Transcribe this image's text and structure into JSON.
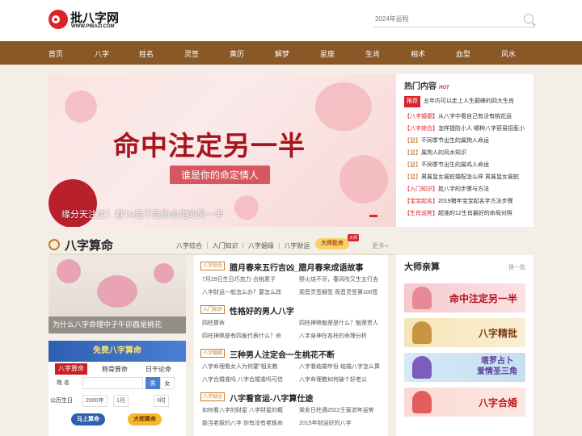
{
  "header": {
    "logo_name": "批八字网",
    "logo_domain": "WWW.PIBAZI.COM",
    "search_placeholder": "2024年运程"
  },
  "nav": {
    "items": [
      "首页",
      "八字",
      "姓名",
      "灵签",
      "黄历",
      "解梦",
      "星座",
      "生肖",
      "相术",
      "血型",
      "风水"
    ]
  },
  "banner": {
    "headline": "命中注定另一半",
    "subline": "谁是你的命定情人",
    "caption": "缘分天注定！看TA是不是你命定的另一半"
  },
  "hot": {
    "title": "热门内容",
    "title_tag": "HOT",
    "top_tag": "推荐",
    "top_text": "五年内可以走上人生巅峰的四大生肖",
    "items": [
      {
        "cat": "【八字婚姻】",
        "text": "从八字中看自己有没有桃花运"
      },
      {
        "cat": "【八字综合】",
        "text": "怎样提防小人 哪种八字容易招惹小"
      },
      {
        "cat": "【鼠】",
        "text": "不同季节出生的属狗人命运"
      },
      {
        "cat": "【鼠】",
        "text": "属狗人的风水知识"
      },
      {
        "cat": "【鼠】",
        "text": "不同季节出生的属鸡人命运"
      },
      {
        "cat": "【鼠】",
        "text": "男属鼠女属蛇婚配怎么样 男属鼠女属蛇"
      },
      {
        "cat": "【入门知识】",
        "text": "批八字的步骤与方法"
      },
      {
        "cat": "【宝宝起名】",
        "text": "2019猪年宝宝起名字方法步骤"
      },
      {
        "cat": "【生肖运势】",
        "text": "超准的12生肖最好的命局对照"
      }
    ]
  },
  "section": {
    "title": "八字算命",
    "links": "八字综合 ｜ 入门知识 ｜ 八字姻缘 ｜ 八字财运",
    "badge": "大师批命",
    "badge_tag": "大师",
    "more": "更多+"
  },
  "feature": {
    "caption": "为什么八字命理中子午卯酉是桃花"
  },
  "calc": {
    "head": "免费八字算命",
    "tabs": [
      "八字算命",
      "称骨算命",
      "日干论命"
    ],
    "name_label": "姓 名",
    "sex_male": "男",
    "sex_female": "女",
    "birth_label": "公历生日",
    "year": "2000年",
    "month": "1月",
    "hour": "0时",
    "btn_quick": "马上算命",
    "btn_master": "大师算命"
  },
  "articles": [
    {
      "cat": "八字综合",
      "title": "腊月春来五行吉凶_腊月春来成语故事",
      "lines": [
        "7月29日生日巧克力·合桃君子",
        "野火烧不尽，春风吹又生五行吉",
        "八字财运一般怎么办？要怎么改",
        "观音灵签解签 观音灵签第100签"
      ]
    },
    {
      "cat": "入门知识",
      "title": "性格好的男人八字",
      "lines": [
        "四柱算命",
        "四柱神煞魁罡是什么？魁罡贵人",
        "四柱神煞是有四废代表什么？命",
        "八字身神在各柱的命理分析"
      ]
    },
    {
      "cat": "八字婚姻",
      "title": "三种男人注定会一生桃花不断",
      "lines": [
        "八字命理看女人为何要\"相夫教",
        "八字看结婚年份 结婚八字怎么算",
        "八字合婚准吗 八字合婚准吗可信",
        "八字命理教如何破个好老公"
      ]
    },
    {
      "cat": "八字财运",
      "title": "八字看官运-八字算仕途",
      "lines": [
        "如何看八字的财星 八字财星的概",
        "癸亥日柱遇2022壬寅流年运势",
        "能当老板的八字 你有没有老板命",
        "2015年财运好的八字"
      ]
    }
  ],
  "masters": {
    "title": "大师亲算",
    "refresh": "换一批",
    "cards": [
      "命中注定另一半",
      "八字精批",
      "塔罗占卜\n爱情圣三角",
      "八字合婚"
    ]
  }
}
